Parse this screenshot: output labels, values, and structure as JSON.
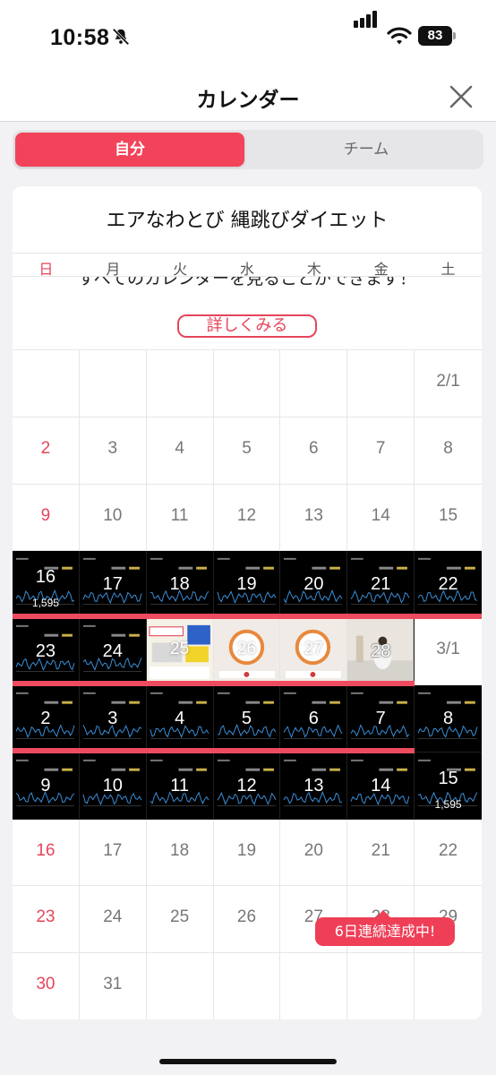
{
  "status_bar": {
    "time": "10:58",
    "battery": "83"
  },
  "nav": {
    "title": "カレンダー"
  },
  "segments": {
    "self": "自分",
    "team": "チーム"
  },
  "calendar": {
    "title": "エアなわとび 縄跳びダイエット",
    "weekdays": [
      "日",
      "月",
      "火",
      "水",
      "木",
      "金",
      "土"
    ],
    "notice": "すべてのカレンダーを見ることができます！",
    "details_button": "詳しくみる",
    "streak_badge": "6日連続達成中!",
    "subtitles": {
      "feb16": "1,595",
      "mar15": "1,595"
    },
    "weeks": [
      [
        "",
        "",
        "",
        "",
        "",
        "",
        "2/1"
      ],
      [
        "2",
        "3",
        "4",
        "5",
        "6",
        "7",
        "8"
      ],
      [
        "9",
        "10",
        "11",
        "12",
        "13",
        "14",
        "15"
      ],
      [
        "16",
        "17",
        "18",
        "19",
        "20",
        "21",
        "22"
      ],
      [
        "23",
        "24",
        "25",
        "26",
        "27",
        "28",
        "3/1"
      ],
      [
        "2",
        "3",
        "4",
        "5",
        "6",
        "7",
        "8"
      ],
      [
        "9",
        "10",
        "11",
        "12",
        "13",
        "14",
        "15"
      ],
      [
        "16",
        "17",
        "18",
        "19",
        "20",
        "21",
        "22"
      ],
      [
        "23",
        "24",
        "25",
        "26",
        "27",
        "28",
        "29"
      ],
      [
        "30",
        "31",
        "",
        "",
        "",
        "",
        ""
      ]
    ]
  },
  "colors": {
    "accent": "#f2435a",
    "sunday": "#e6455b",
    "streak": "#ee4b60"
  }
}
